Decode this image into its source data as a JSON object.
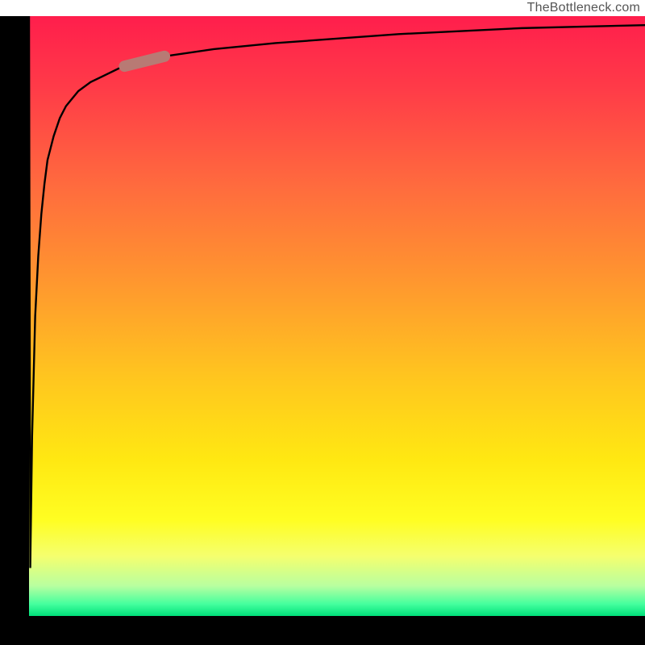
{
  "attribution": "TheBottleneck.com",
  "colors": {
    "axis": "#000000",
    "curve": "#000000",
    "marker": "#b87a74",
    "gradient_top": "#ff1e4c",
    "gradient_bottom": "#00e07a"
  },
  "chart_data": {
    "type": "line",
    "title": "",
    "xlabel": "",
    "ylabel": "",
    "xlim": [
      0,
      100
    ],
    "ylim": [
      0,
      100
    ],
    "grid": false,
    "legend": false,
    "annotations": [],
    "series": [
      {
        "name": "curve",
        "x": [
          0,
          0.2,
          0.5,
          1.0,
          1.5,
          2.0,
          2.5,
          3.0,
          4.0,
          5.0,
          6.0,
          8.0,
          10.0,
          12.0,
          15.0,
          20.0,
          30.0,
          40.0,
          60.0,
          80.0,
          100.0
        ],
        "y": [
          100,
          8,
          30,
          50,
          60,
          67,
          72,
          76,
          80,
          83,
          85,
          87.5,
          89,
          90,
          91.5,
          93,
          94.5,
          95.5,
          97,
          98,
          98.5
        ]
      }
    ],
    "marker": {
      "on_series": "curve",
      "x_range": [
        15.5,
        22.0
      ],
      "shape": "capsule",
      "color": "#b87a74"
    }
  }
}
